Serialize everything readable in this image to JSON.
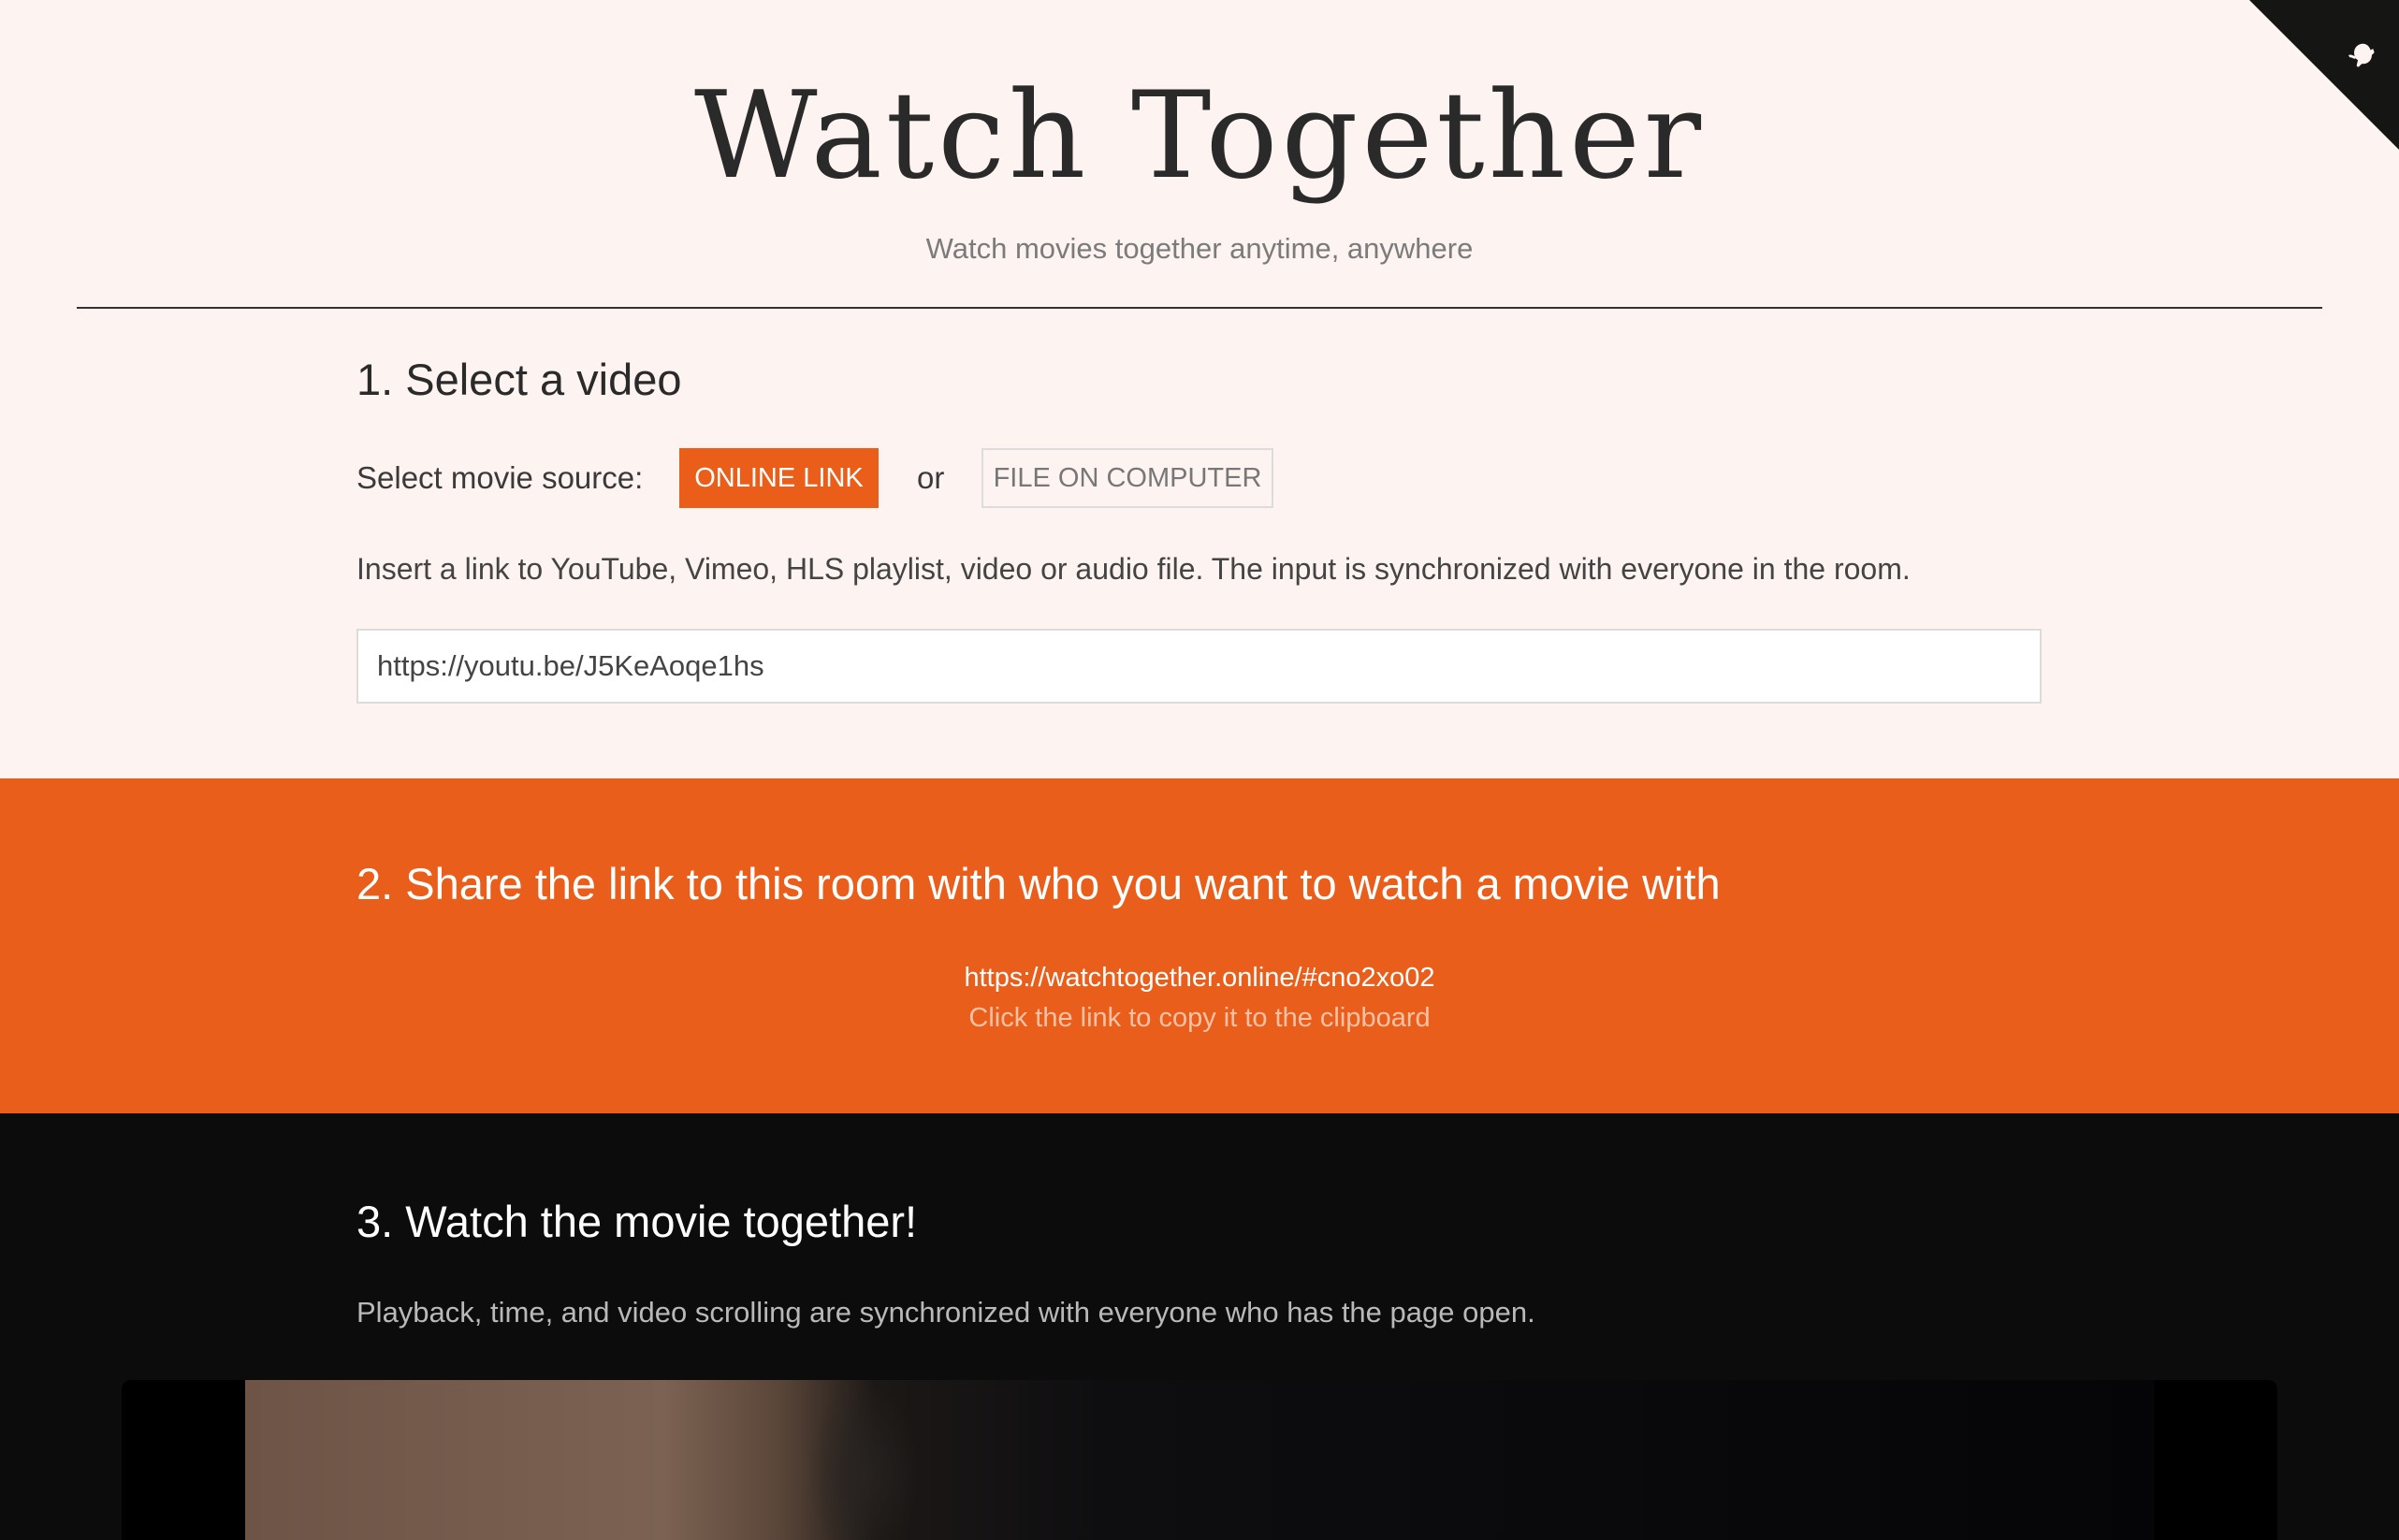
{
  "header": {
    "title": "Watch Together",
    "subtitle": "Watch movies together anytime, anywhere",
    "corner_icon": "github-octocat-icon"
  },
  "step1": {
    "heading": "1. Select a video",
    "source_label": "Select movie source:",
    "online_link_label": "ONLINE LINK",
    "or_label": "or",
    "file_label": "FILE ON COMPUTER",
    "description": "Insert a link to YouTube, Vimeo, HLS playlist, video or audio file. The input is synchronized with everyone in the room.",
    "url_value": "https://youtu.be/J5KeAoqe1hs"
  },
  "step2": {
    "heading": "2. Share the link to this room with who you want to watch a movie with",
    "room_link": "https://watchtogether.online/#cno2xo02",
    "hint": "Click the link to copy it to the clipboard"
  },
  "step3": {
    "heading": "3. Watch the movie together!",
    "description": "Playback, time, and video scrolling are synchronized with everyone who has the page open."
  },
  "colors": {
    "accent": "#ea5e1b",
    "page_background": "#fdf3f1",
    "dark_section": "#0c0c0c"
  }
}
